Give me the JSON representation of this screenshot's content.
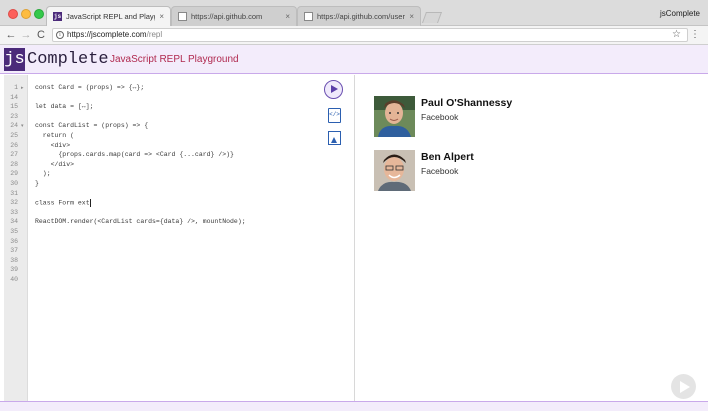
{
  "browser": {
    "tabs": [
      {
        "title": "JavaScript REPL and Playground",
        "favicon": "jscomplete-icon",
        "active": true
      },
      {
        "title": "https://api.github.com",
        "favicon": "page-icon",
        "active": false
      },
      {
        "title": "https://api.github.com/users/",
        "favicon": "page-icon",
        "active": false
      }
    ],
    "close_glyph": "×",
    "profile": "jsComplete",
    "url_host": "https://jscomplete.com",
    "url_path": "/repl",
    "nav": {
      "back": "←",
      "forward": "→",
      "reload": "C"
    },
    "star": "☆",
    "menu": "⋮"
  },
  "app": {
    "logo_js": "js",
    "logo_rest": "Complete",
    "subtitle": "JavaScript REPL Playground",
    "brand_color": "#4b2a7a",
    "accent_color": "#b0294f"
  },
  "editor": {
    "lines": [
      {
        "num": "1",
        "fold": "▸",
        "code": "const Card = (props) => {↔};"
      },
      {
        "num": "14",
        "fold": "",
        "code": ""
      },
      {
        "num": "15",
        "fold": "",
        "code": "let data = [↔];"
      },
      {
        "num": "23",
        "fold": "",
        "code": ""
      },
      {
        "num": "24",
        "fold": "▾",
        "code": "const CardList = (props) => {"
      },
      {
        "num": "25",
        "fold": "",
        "code": "  return ("
      },
      {
        "num": "26",
        "fold": "",
        "code": "    <div>"
      },
      {
        "num": "27",
        "fold": "",
        "code": "      {props.cards.map(card => <Card {...card} />)}"
      },
      {
        "num": "28",
        "fold": "",
        "code": "    </div>"
      },
      {
        "num": "29",
        "fold": "",
        "code": "  );"
      },
      {
        "num": "30",
        "fold": "",
        "code": "}"
      },
      {
        "num": "31",
        "fold": "",
        "code": ""
      },
      {
        "num": "32",
        "fold": "",
        "code": "class Form ext",
        "cursor": true
      },
      {
        "num": "33",
        "fold": "",
        "code": ""
      },
      {
        "num": "34",
        "fold": "",
        "code": "ReactDOM.render(<CardList cards={data} />, mountNode);"
      },
      {
        "num": "35",
        "fold": "",
        "code": ""
      },
      {
        "num": "36",
        "fold": "",
        "code": ""
      },
      {
        "num": "37",
        "fold": "",
        "code": ""
      },
      {
        "num": "38",
        "fold": "",
        "code": ""
      },
      {
        "num": "39",
        "fold": "",
        "code": ""
      },
      {
        "num": "40",
        "fold": "",
        "code": ""
      }
    ]
  },
  "tools": {
    "run_icon": "play-icon",
    "code_icon": "code-icon",
    "code_glyph": "</>",
    "image_icon": "image-icon"
  },
  "preview": {
    "cards": [
      {
        "name": "Paul O'Shannessy",
        "company": "Facebook",
        "avatar": "avatar-paul"
      },
      {
        "name": "Ben Alpert",
        "company": "Facebook",
        "avatar": "avatar-ben"
      }
    ]
  }
}
